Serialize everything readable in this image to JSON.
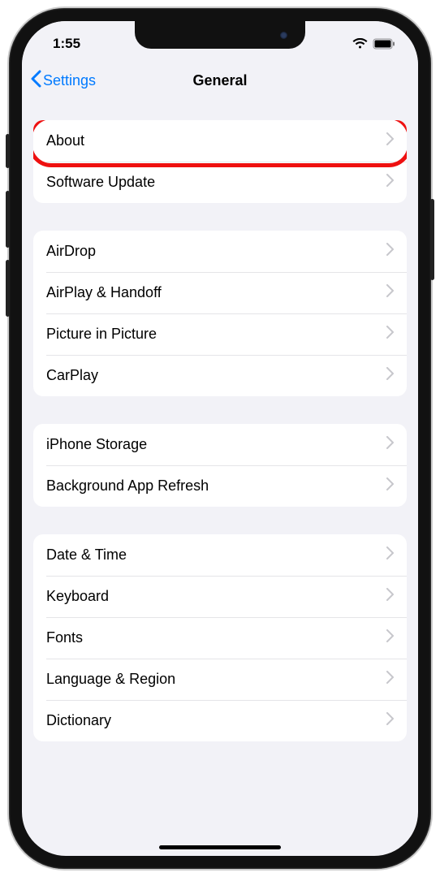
{
  "statusBar": {
    "time": "1:55"
  },
  "nav": {
    "back": "Settings",
    "title": "General"
  },
  "groups": [
    {
      "items": [
        {
          "label": "About",
          "highlighted": true
        },
        {
          "label": "Software Update"
        }
      ]
    },
    {
      "items": [
        {
          "label": "AirDrop"
        },
        {
          "label": "AirPlay & Handoff"
        },
        {
          "label": "Picture in Picture"
        },
        {
          "label": "CarPlay"
        }
      ]
    },
    {
      "items": [
        {
          "label": "iPhone Storage"
        },
        {
          "label": "Background App Refresh"
        }
      ]
    },
    {
      "items": [
        {
          "label": "Date & Time"
        },
        {
          "label": "Keyboard"
        },
        {
          "label": "Fonts"
        },
        {
          "label": "Language & Region"
        },
        {
          "label": "Dictionary"
        }
      ]
    }
  ]
}
